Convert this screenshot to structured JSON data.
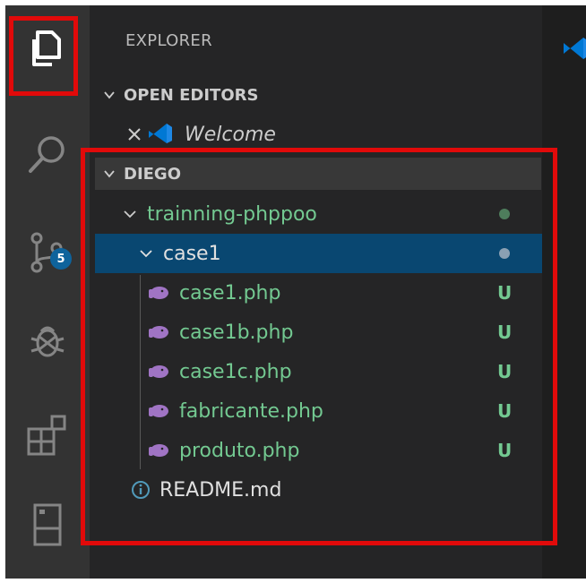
{
  "explorer": {
    "title": "EXPLORER"
  },
  "open_editors": {
    "header": "OPEN EDITORS",
    "items": [
      {
        "label": "Welcome"
      }
    ]
  },
  "workspace": {
    "header": "DIEGO",
    "folder": {
      "label": "trainning-phppoo"
    },
    "subfolder": {
      "label": "case1"
    },
    "files": [
      {
        "label": "case1.php",
        "status": "U"
      },
      {
        "label": "case1b.php",
        "status": "U"
      },
      {
        "label": "case1c.php",
        "status": "U"
      },
      {
        "label": "fabricante.php",
        "status": "U"
      },
      {
        "label": "produto.php",
        "status": "U"
      }
    ],
    "readme": {
      "label": "README.md"
    }
  },
  "activity_bar": {
    "items": [
      "explorer",
      "search",
      "source-control",
      "debug",
      "extensions",
      "remote-explorer"
    ],
    "scm_badge": "5"
  },
  "colors": {
    "accent": "#0e639c",
    "untracked": "#73c991",
    "selection": "#094771",
    "highlight": "#e10a0a"
  }
}
